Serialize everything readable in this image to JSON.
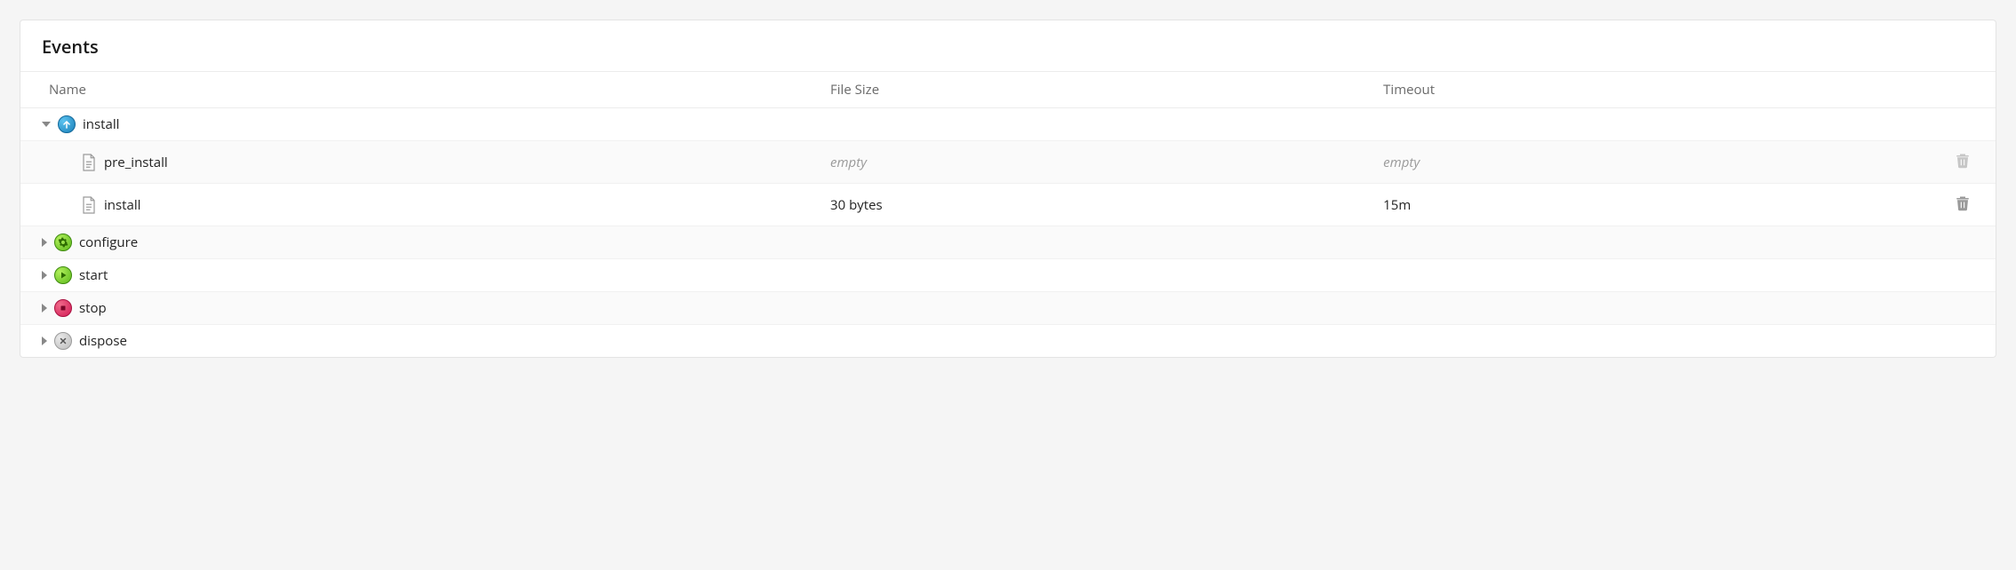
{
  "panel": {
    "title": "Events"
  },
  "columns": {
    "name": "Name",
    "size": "File Size",
    "timeout": "Timeout"
  },
  "events": [
    {
      "label": "install",
      "kind": "install",
      "expanded": true,
      "children": [
        {
          "label": "pre_install",
          "size": "empty",
          "size_empty": true,
          "timeout": "empty",
          "timeout_empty": true
        },
        {
          "label": "install",
          "size": "30 bytes",
          "size_empty": false,
          "timeout": "15m",
          "timeout_empty": false
        }
      ]
    },
    {
      "label": "configure",
      "kind": "configure",
      "expanded": false
    },
    {
      "label": "start",
      "kind": "start",
      "expanded": false
    },
    {
      "label": "stop",
      "kind": "stop",
      "expanded": false
    },
    {
      "label": "dispose",
      "kind": "dispose",
      "expanded": false
    }
  ]
}
